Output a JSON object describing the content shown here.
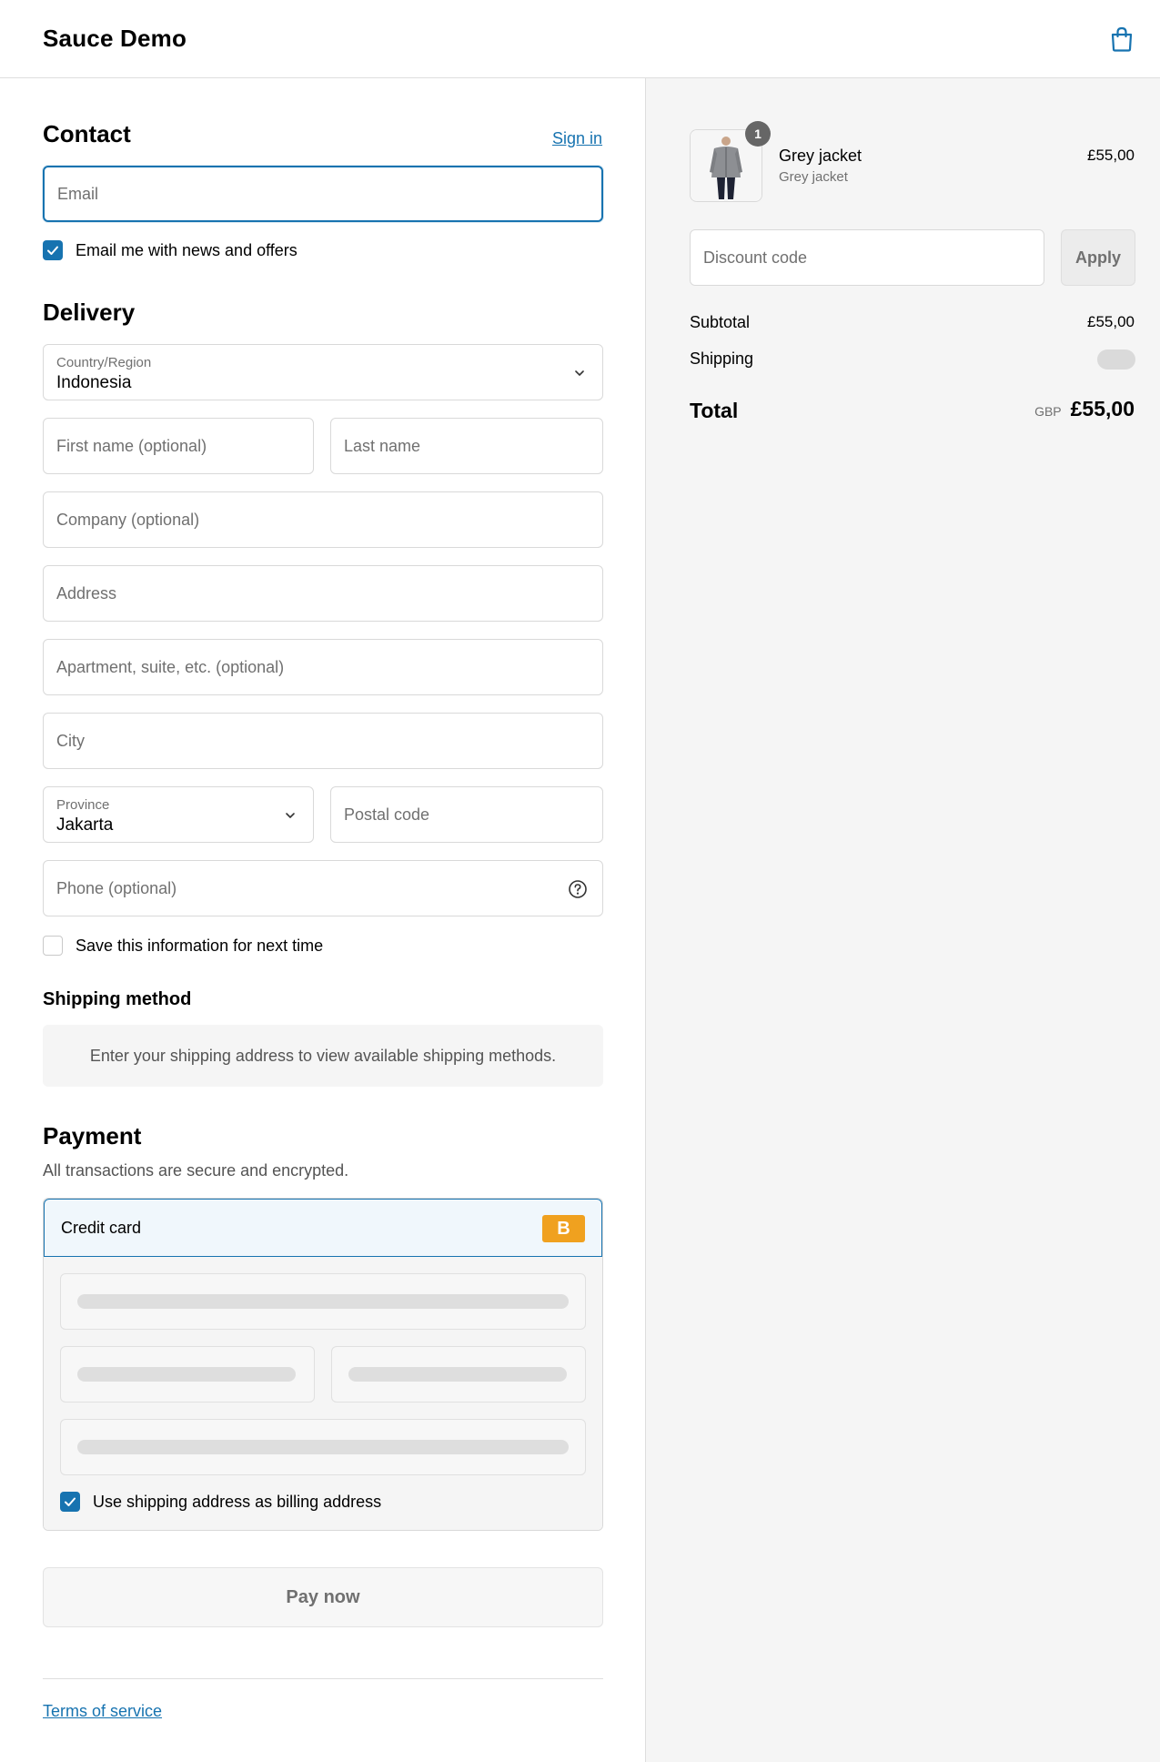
{
  "header": {
    "brand": "Sauce Demo",
    "cart_icon": "shopping-bag-icon"
  },
  "contact": {
    "title": "Contact",
    "sign_in": "Sign in",
    "email_placeholder": "Email",
    "news_label": "Email me with news and offers",
    "news_checked": true
  },
  "delivery": {
    "title": "Delivery",
    "country_label": "Country/Region",
    "country_value": "Indonesia",
    "first_name_placeholder": "First name (optional)",
    "last_name_placeholder": "Last name",
    "company_placeholder": "Company (optional)",
    "address_placeholder": "Address",
    "apartment_placeholder": "Apartment, suite, etc. (optional)",
    "city_placeholder": "City",
    "province_label": "Province",
    "province_value": "Jakarta",
    "postal_placeholder": "Postal code",
    "phone_placeholder": "Phone (optional)",
    "save_label": "Save this information for next time",
    "save_checked": false
  },
  "shipping_method": {
    "title": "Shipping method",
    "notice": "Enter your shipping address to view available shipping methods."
  },
  "payment": {
    "title": "Payment",
    "subtitle": "All transactions are secure and encrypted.",
    "method_label": "Credit card",
    "badge": "B",
    "billing_label": "Use shipping address as billing address",
    "billing_checked": true,
    "pay_button": "Pay now"
  },
  "footer": {
    "terms": "Terms of service"
  },
  "summary": {
    "item_name": "Grey jacket",
    "item_variant": "Grey jacket",
    "item_qty": "1",
    "item_price": "£55,00",
    "discount_placeholder": "Discount code",
    "apply_label": "Apply",
    "subtotal_label": "Subtotal",
    "subtotal_value": "£55,00",
    "shipping_label": "Shipping",
    "total_label": "Total",
    "currency": "GBP",
    "total_value": "£55,00"
  },
  "colors": {
    "accent": "#1773b0",
    "badge": "#f0a11f",
    "summary_bg": "#f5f5f5"
  }
}
